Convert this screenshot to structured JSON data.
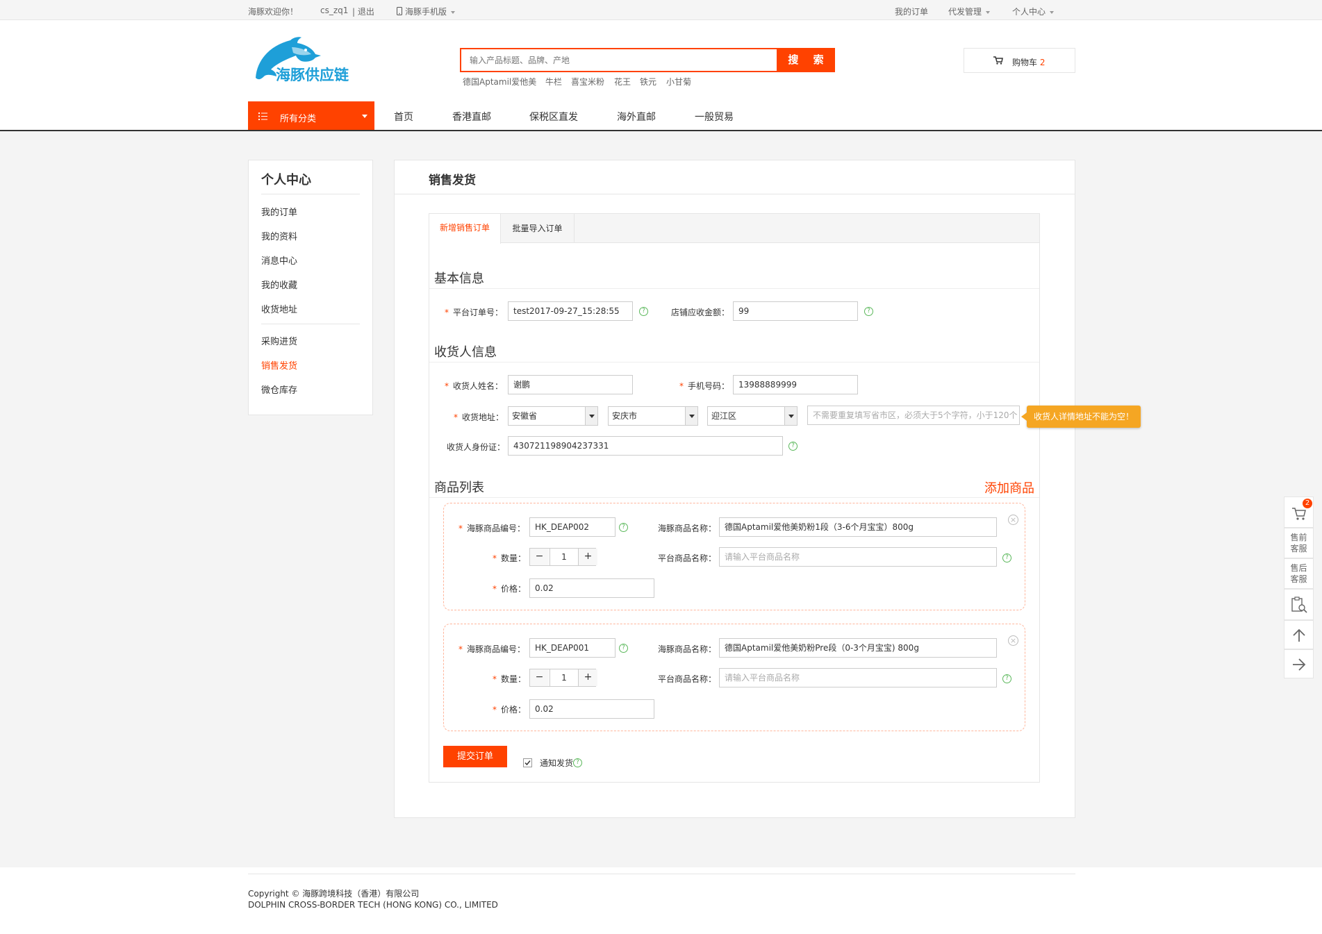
{
  "topbar": {
    "welcome": "海豚欢迎你！",
    "username": "cs_zq1",
    "logout": "| 退出",
    "mobile": "海豚手机版",
    "my_orders": "我的订单",
    "dropship": "代发管理",
    "personal": "个人中心"
  },
  "header": {
    "logo_text": "海豚供应链",
    "search_placeholder": "输入产品标题、品牌、产地",
    "search_button": "搜 索",
    "hot_keywords": [
      "德国Aptamil爱他美",
      "牛栏",
      "喜宝米粉",
      "花王",
      "铁元",
      "小甘菊"
    ],
    "cart_label": "购物车",
    "cart_count": "2"
  },
  "nav": {
    "all_categories": "所有分类",
    "links": [
      "首页",
      "香港直邮",
      "保税区直发",
      "海外直邮",
      "一般贸易"
    ]
  },
  "sidebar": {
    "title": "个人中心",
    "group1": [
      "我的订单",
      "我的资料",
      "消息中心",
      "我的收藏",
      "收货地址"
    ],
    "group2": [
      "采购进货",
      "销售发货",
      "微仓库存"
    ],
    "active": "销售发货"
  },
  "main": {
    "title": "销售发货",
    "tabs": [
      "新增销售订单",
      "批量导入订单"
    ],
    "basic": {
      "title": "基本信息",
      "order_no_label": "平台订单号：",
      "order_no_value": "test2017-09-27_15:28:55",
      "amount_label": "店铺应收金额：",
      "amount_value": "99"
    },
    "receiver": {
      "title": "收货人信息",
      "name_label": "收货人姓名：",
      "name_value": "谢鹏",
      "phone_label": "手机号码：",
      "phone_value": "13988889999",
      "address_label": "收货地址：",
      "province": "安徽省",
      "city": "安庆市",
      "district": "迎江区",
      "detail_placeholder": "不需要重复填写省市区，必须大于5个字符，小于120个",
      "error_tip": "收货人详情地址不能为空！",
      "id_label": "收货人身份证：",
      "id_value": "430721198904237331"
    },
    "products": {
      "title": "商品列表",
      "add_link": "添加商品",
      "code_label": "海豚商品编号：",
      "name_label": "海豚商品名称：",
      "qty_label": "数量：",
      "platform_name_label": "平台商品名称：",
      "platform_name_placeholder": "请输入平台商品名称",
      "price_label": "价格：",
      "items": [
        {
          "code": "HK_DEAP002",
          "name": "德国Aptamil爱他美奶粉1段（3-6个月宝宝）800g",
          "qty": "1",
          "price": "0.02"
        },
        {
          "code": "HK_DEAP001",
          "name": "德国Aptamil爱他美奶粉Pre段（0-3个月宝宝) 800g",
          "qty": "1",
          "price": "0.02"
        }
      ]
    },
    "submit": "提交订单",
    "notify": "通知发货"
  },
  "right_bar": {
    "cart_badge": "2",
    "presale": "售前客服",
    "aftersale": "售后客服"
  },
  "footer": {
    "line1": "Copyright ©  海豚跨境科技（香港）有限公司",
    "line2": "DOLPHIN CROSS-BORDER TECH (HONG KONG) CO., LIMITED"
  },
  "colors": {
    "accent": "#ff4200",
    "logo_blue": "#1e9fd8",
    "help_green": "#5bb85b",
    "tooltip": "#f5a623"
  }
}
